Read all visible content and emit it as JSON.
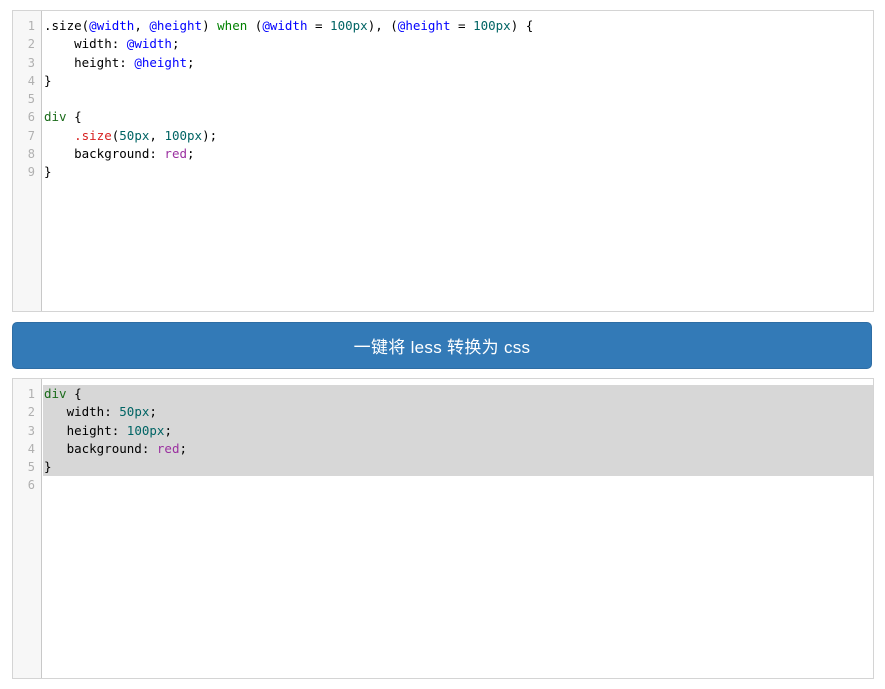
{
  "page": {
    "title": "Less to CSS converter",
    "background": "#ffffff"
  },
  "colors": {
    "button_bg": "#337ab7",
    "button_border": "#2e6da4",
    "button_text": "#ffffff",
    "editor_border": "#d4d4d4",
    "gutter_bg": "#f7f7f7",
    "gutter_text": "#b0b0b0",
    "selection_bg": "#d7d7d7",
    "token_variable": "#0000ff",
    "token_keyword": "#008000",
    "token_number": "#006464",
    "token_selector": "#1a6b1a",
    "token_mixin_call": "#d72020",
    "token_value": "#9b30a0",
    "token_plain": "#000000"
  },
  "input_editor": {
    "name": "less-source-editor",
    "language": "less",
    "line_numbers": [
      "1",
      "2",
      "3",
      "4",
      "5",
      "6",
      "7",
      "8",
      "9"
    ],
    "lines": [
      {
        "number": "1",
        "selected": false,
        "tokens": [
          {
            "text": ".size",
            "type": "plain"
          },
          {
            "text": "(",
            "type": "plain"
          },
          {
            "text": "@width",
            "type": "var"
          },
          {
            "text": ", ",
            "type": "plain"
          },
          {
            "text": "@height",
            "type": "var"
          },
          {
            "text": ") ",
            "type": "plain"
          },
          {
            "text": "when",
            "type": "kw"
          },
          {
            "text": " (",
            "type": "plain"
          },
          {
            "text": "@width",
            "type": "var"
          },
          {
            "text": " = ",
            "type": "plain"
          },
          {
            "text": "100px",
            "type": "num"
          },
          {
            "text": "), (",
            "type": "plain"
          },
          {
            "text": "@height",
            "type": "var"
          },
          {
            "text": " = ",
            "type": "plain"
          },
          {
            "text": "100px",
            "type": "num"
          },
          {
            "text": ") {",
            "type": "plain"
          }
        ]
      },
      {
        "number": "2",
        "selected": false,
        "tokens": [
          {
            "text": "    width: ",
            "type": "prop"
          },
          {
            "text": "@width",
            "type": "var"
          },
          {
            "text": ";",
            "type": "plain"
          }
        ]
      },
      {
        "number": "3",
        "selected": false,
        "tokens": [
          {
            "text": "    height: ",
            "type": "prop"
          },
          {
            "text": "@height",
            "type": "var"
          },
          {
            "text": ";",
            "type": "plain"
          }
        ]
      },
      {
        "number": "4",
        "selected": false,
        "tokens": [
          {
            "text": "}",
            "type": "plain"
          }
        ]
      },
      {
        "number": "5",
        "selected": false,
        "tokens": [
          {
            "text": "",
            "type": "plain"
          }
        ]
      },
      {
        "number": "6",
        "selected": false,
        "tokens": [
          {
            "text": "div",
            "type": "sel"
          },
          {
            "text": " {",
            "type": "plain"
          }
        ]
      },
      {
        "number": "7",
        "selected": false,
        "tokens": [
          {
            "text": "    ",
            "type": "plain"
          },
          {
            "text": ".size",
            "type": "mixin"
          },
          {
            "text": "(",
            "type": "plain"
          },
          {
            "text": "50px",
            "type": "num"
          },
          {
            "text": ", ",
            "type": "plain"
          },
          {
            "text": "100px",
            "type": "num"
          },
          {
            "text": ");",
            "type": "plain"
          }
        ]
      },
      {
        "number": "8",
        "selected": false,
        "tokens": [
          {
            "text": "    background: ",
            "type": "prop"
          },
          {
            "text": "red",
            "type": "val"
          },
          {
            "text": ";",
            "type": "plain"
          }
        ]
      },
      {
        "number": "9",
        "selected": false,
        "tokens": [
          {
            "text": "}",
            "type": "plain"
          }
        ]
      }
    ]
  },
  "convert_button": {
    "label": "一键将 less 转换为 css"
  },
  "output_editor": {
    "name": "css-output-editor",
    "language": "css",
    "line_numbers": [
      "1",
      "2",
      "3",
      "4",
      "5",
      "6"
    ],
    "lines": [
      {
        "number": "1",
        "selected": true,
        "tokens": [
          {
            "text": "div",
            "type": "sel"
          },
          {
            "text": " {",
            "type": "plain"
          }
        ]
      },
      {
        "number": "2",
        "selected": true,
        "tokens": [
          {
            "text": "   width: ",
            "type": "prop"
          },
          {
            "text": "50px",
            "type": "num"
          },
          {
            "text": ";",
            "type": "plain"
          }
        ]
      },
      {
        "number": "3",
        "selected": true,
        "tokens": [
          {
            "text": "   height: ",
            "type": "prop"
          },
          {
            "text": "100px",
            "type": "num"
          },
          {
            "text": ";",
            "type": "plain"
          }
        ]
      },
      {
        "number": "4",
        "selected": true,
        "tokens": [
          {
            "text": "   background: ",
            "type": "prop"
          },
          {
            "text": "red",
            "type": "val"
          },
          {
            "text": ";",
            "type": "plain"
          }
        ]
      },
      {
        "number": "5",
        "selected": true,
        "tokens": [
          {
            "text": "}",
            "type": "plain"
          }
        ]
      },
      {
        "number": "6",
        "selected": false,
        "tokens": [
          {
            "text": "",
            "type": "plain"
          }
        ]
      }
    ]
  }
}
